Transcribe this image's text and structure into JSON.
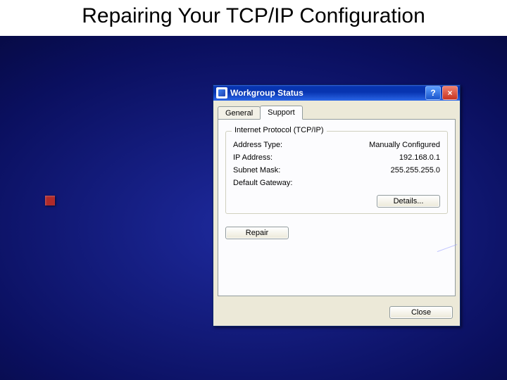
{
  "slide": {
    "title": "Repairing Your TCP/IP Configuration"
  },
  "dialog": {
    "title": "Workgroup Status",
    "help_glyph": "?",
    "close_glyph": "×",
    "tabs": {
      "general": "General",
      "support": "Support"
    },
    "group_legend": "Internet Protocol (TCP/IP)",
    "rows": {
      "address_type": {
        "label": "Address Type:",
        "value": "Manually Configured"
      },
      "ip_address": {
        "label": "IP Address:",
        "value": "192.168.0.1"
      },
      "subnet_mask": {
        "label": "Subnet Mask:",
        "value": "255.255.255.0"
      },
      "gateway": {
        "label": "Default Gateway:",
        "value": ""
      }
    },
    "buttons": {
      "details": "Details...",
      "repair": "Repair",
      "close": "Close"
    }
  }
}
